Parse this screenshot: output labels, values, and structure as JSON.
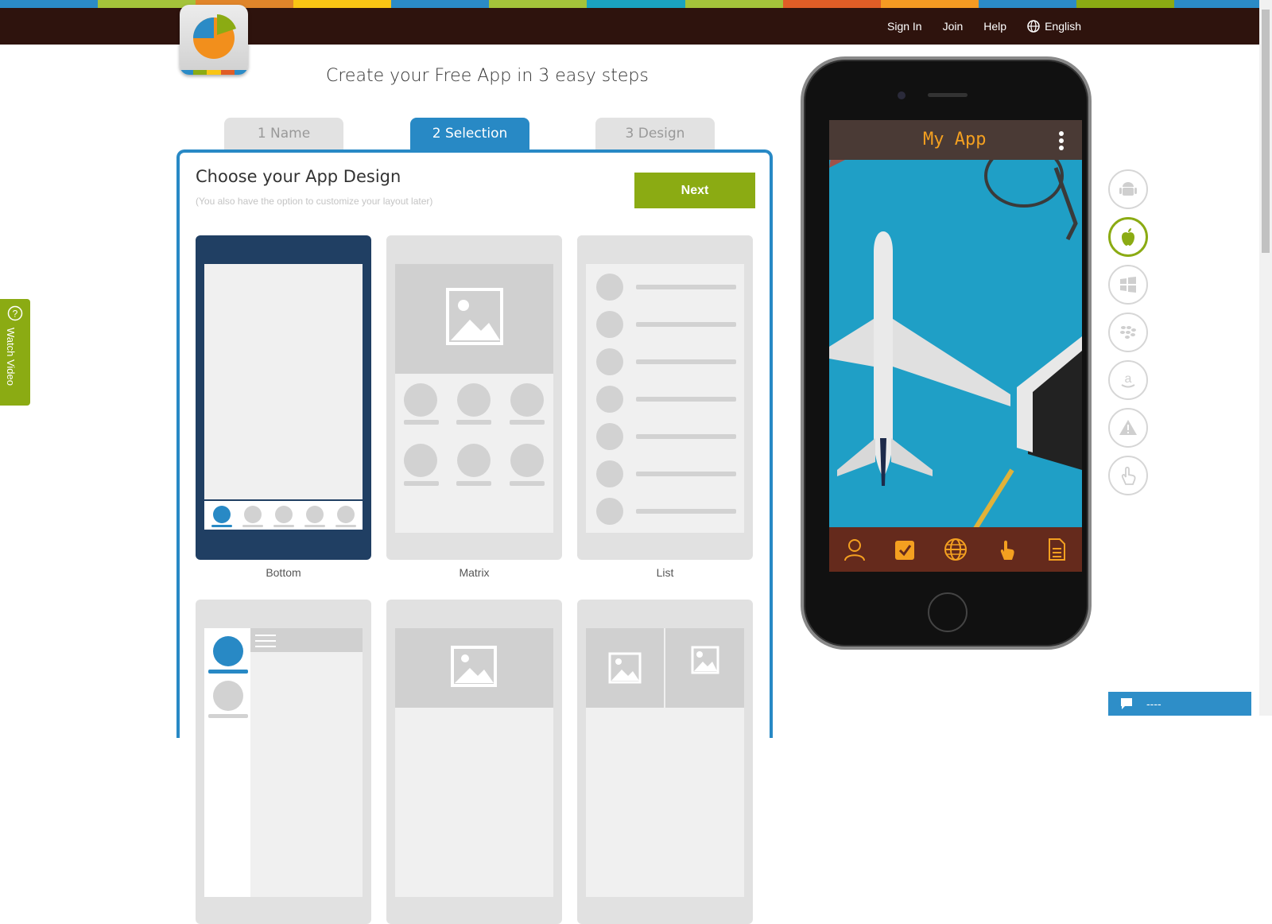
{
  "colors": {
    "stripe": [
      "#2b8bc6",
      "#a4c33a",
      "#e0852a",
      "#f9c514",
      "#2b8bc6",
      "#a4c33a",
      "#1aa3c0",
      "#a4c33a",
      "#e05d26",
      "#f59a22",
      "#2b8bc6",
      "#8bab13",
      "#2b8bc6"
    ],
    "accent_blue": "#2889c5",
    "accent_green": "#8bab13",
    "nav_bg": "#2e130d"
  },
  "nav": {
    "sign_in": "Sign In",
    "join": "Join",
    "help": "Help",
    "language": "English"
  },
  "headline": "Create your Free App in 3 easy steps",
  "steps": [
    {
      "label": "1 Name",
      "active": false
    },
    {
      "label": "2 Selection",
      "active": true
    },
    {
      "label": "3 Design",
      "active": false
    }
  ],
  "panel": {
    "title": "Choose your App Design",
    "subtitle": "(You also have the option to customize your layout later)",
    "next_label": "Next"
  },
  "layouts": [
    {
      "label": "Bottom",
      "selected": true
    },
    {
      "label": "Matrix",
      "selected": false
    },
    {
      "label": "List",
      "selected": false
    }
  ],
  "watch_video": "Watch Video",
  "preview": {
    "app_title": "My App",
    "menu_icon": "kebab-menu-icon",
    "bottom_icons": [
      "user-icon",
      "checklist-icon",
      "globe-icon",
      "touch-icon",
      "document-icon"
    ]
  },
  "platforms": [
    {
      "name": "android-icon",
      "active": false
    },
    {
      "name": "apple-icon",
      "active": true
    },
    {
      "name": "windows-icon",
      "active": false
    },
    {
      "name": "blackberry-icon",
      "active": false
    },
    {
      "name": "amazon-icon",
      "active": false
    },
    {
      "name": "warning-icon",
      "active": false
    },
    {
      "name": "touch-icon",
      "active": false
    }
  ],
  "chat": {
    "label": "----"
  }
}
